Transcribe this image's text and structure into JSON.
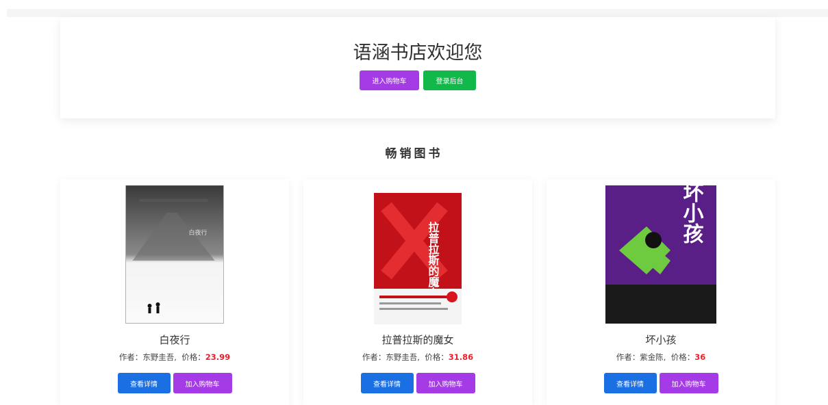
{
  "hero": {
    "title": "语涵书店欢迎您",
    "cart_button": "进入购物车",
    "admin_button": "登录后台"
  },
  "section": {
    "title": "畅销图书"
  },
  "labels": {
    "author": "作者：",
    "price": "价格："
  },
  "books": [
    {
      "title": "白夜行",
      "author": "东野圭吾,",
      "price": "23.99",
      "detail_button": "查看详情",
      "cart_button": "加入购物车",
      "cover_text": "白夜行"
    },
    {
      "title": "拉普拉斯的魔女",
      "author": "东野圭吾,",
      "price": "31.86",
      "detail_button": "查看详情",
      "cart_button": "加入购物车",
      "cover_text": "拉普拉斯的魔女"
    },
    {
      "title": "坏小孩",
      "author": "紫金陈,",
      "price": "36",
      "detail_button": "查看详情",
      "cart_button": "加入购物车",
      "cover_text": "坏小孩"
    }
  ],
  "colors": {
    "purple": "#a53be7",
    "green": "#12b849",
    "blue": "#1a6fe3",
    "price": "#e8222c"
  }
}
